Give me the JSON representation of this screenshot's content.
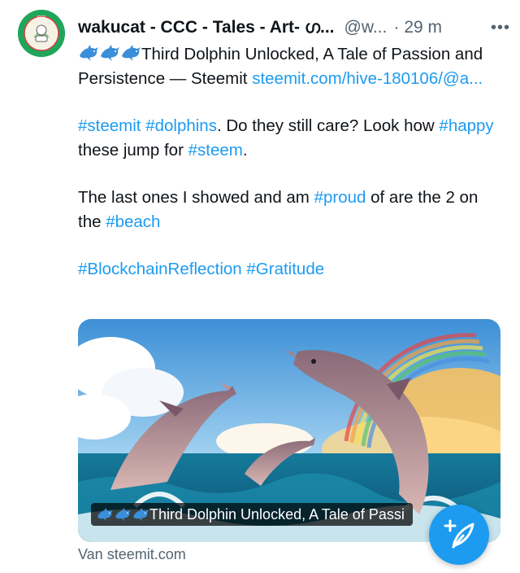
{
  "post": {
    "author_name": "wakucat - CCC - Tales - Art- ഗ...",
    "handle": "@w...",
    "separator": "·",
    "time": "29 m",
    "more_label": "•••",
    "line1": {
      "emoji_icons": [
        "dolphin-icon",
        "dolphin-icon",
        "dolphin-icon"
      ],
      "text": "Third Dolphin Unlocked, A Tale of Passion and Persistence — Steemit ",
      "link": "steemit.com/hive-180106/@a..."
    },
    "para2": {
      "tag_steemit": "#steemit",
      "space1": " ",
      "tag_dolphins": "#dolphins",
      "text1": ". Do they still care? Look how ",
      "tag_happy": "#happy",
      "text2": " these jump for ",
      "tag_steem": "#steem",
      "text3": "."
    },
    "para3": {
      "text1": "The last ones I showed and am ",
      "tag_proud": "#proud",
      "text2": " of are the 2 on the ",
      "tag_beach": "#beach"
    },
    "para4": {
      "tag_reflection": "#BlockchainReflection",
      "space": " ",
      "tag_gratitude": "#Gratitude"
    },
    "media": {
      "image_description": "dolphins-leaping-over-ocean-with-rainbow",
      "caption_text": "Third Dolphin Unlocked, A Tale of Passi"
    },
    "source": "Van steemit.com"
  },
  "fab": {
    "icon": "compose-plus-icon"
  },
  "colors": {
    "link": "#1d9bf0",
    "text": "#0f1419",
    "muted": "#536471",
    "avatar_bg": "#1fa65a"
  }
}
